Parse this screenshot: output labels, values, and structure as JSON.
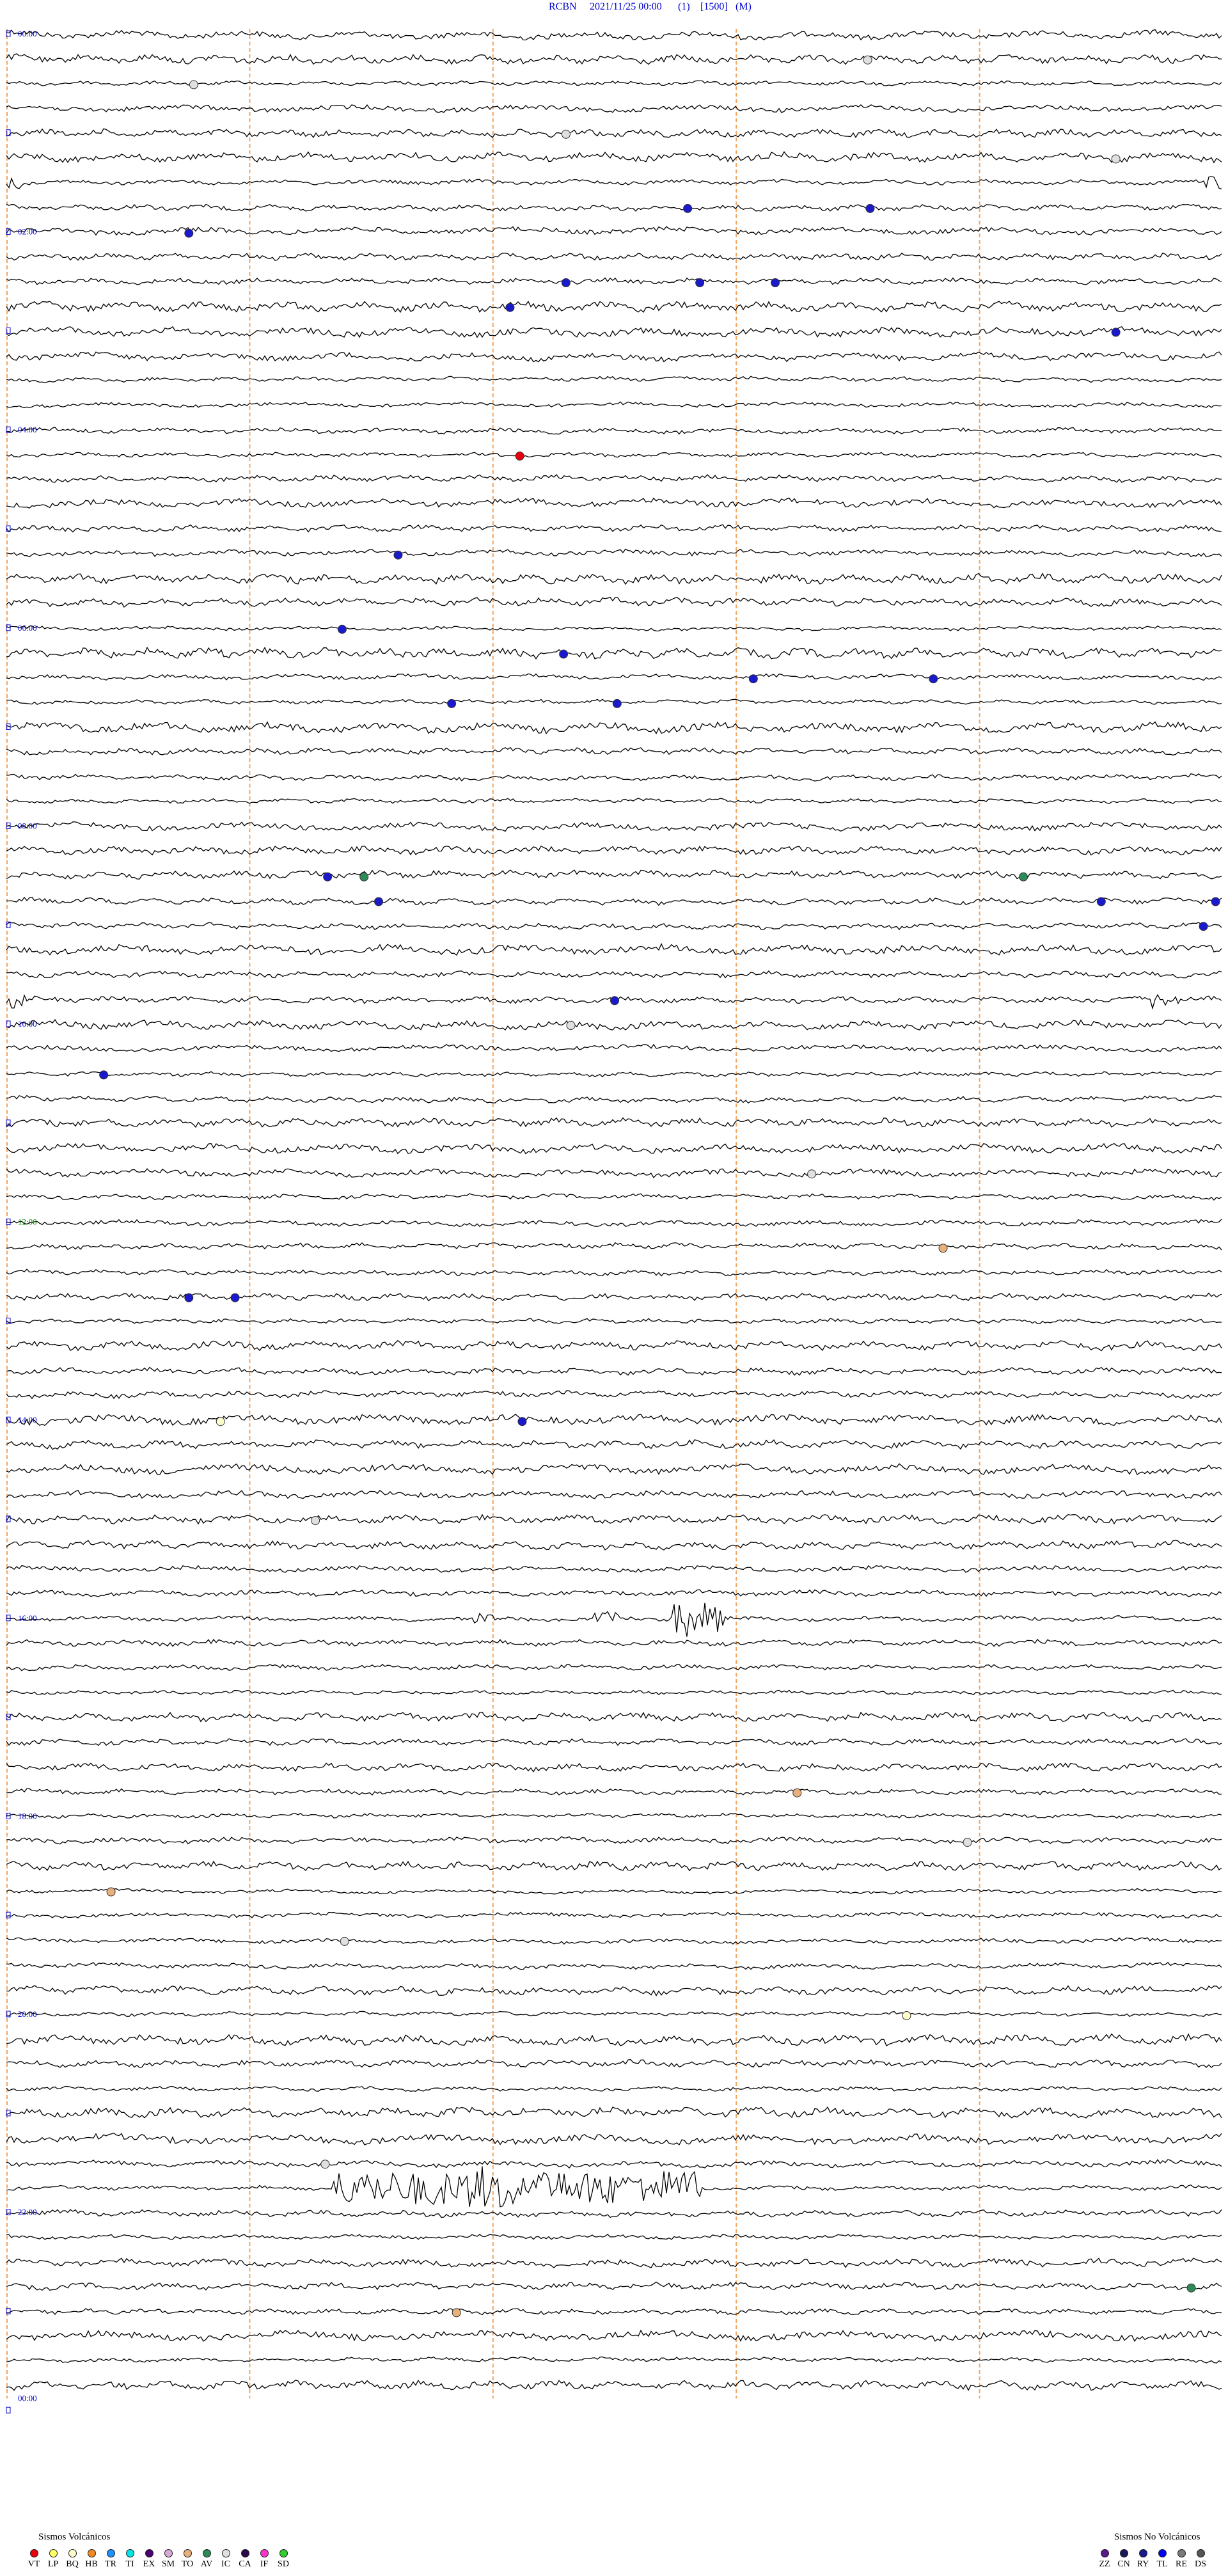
{
  "header": {
    "station": "RCBN",
    "datetime": "2021/11/25 00:00",
    "component": "(1)",
    "scale": "[1500]",
    "mode": "(M)"
  },
  "colors": {
    "trace": "#000000",
    "minute_marker": "#f4a460",
    "time_label": "#0000cc",
    "time_label_noon": "#008800"
  },
  "chart_data": {
    "type": "helicorder",
    "rows_per_hour": 4,
    "hours": 24,
    "time_labels": [
      "00:00",
      "02:00",
      "04:00",
      "06:00",
      "08:00",
      "10:00",
      "12:00",
      "14:00",
      "16:00",
      "18:00",
      "20:00",
      "22:00",
      "00:00"
    ],
    "minute_marks": [
      10,
      20,
      30,
      40
    ],
    "events": [
      {
        "row": 7,
        "minute": 28.0,
        "type": "LP"
      },
      {
        "row": 7,
        "minute": 35.5,
        "type": "LP"
      },
      {
        "row": 8,
        "minute": 7.5,
        "type": "LP"
      },
      {
        "row": 10,
        "minute": 23.0,
        "type": "LP"
      },
      {
        "row": 10,
        "minute": 28.5,
        "type": "LP"
      },
      {
        "row": 10,
        "minute": 31.6,
        "type": "LP"
      },
      {
        "row": 11,
        "minute": 20.7,
        "type": "LP"
      },
      {
        "row": 12,
        "minute": 45.6,
        "type": "LP"
      },
      {
        "row": 17,
        "minute": 21.1,
        "type": "VT"
      },
      {
        "row": 21,
        "minute": 16.1,
        "type": "LP"
      },
      {
        "row": 24,
        "minute": 13.8,
        "type": "LP"
      },
      {
        "row": 25,
        "minute": 22.9,
        "type": "LP"
      },
      {
        "row": 26,
        "minute": 30.7,
        "type": "LP"
      },
      {
        "row": 26,
        "minute": 38.1,
        "type": "LP"
      },
      {
        "row": 27,
        "minute": 18.3,
        "type": "LP"
      },
      {
        "row": 27,
        "minute": 25.1,
        "type": "LP"
      },
      {
        "row": 34,
        "minute": 13.2,
        "type": "LP"
      },
      {
        "row": 34,
        "minute": 14.7,
        "type": "AV"
      },
      {
        "row": 34,
        "minute": 41.8,
        "type": "AV"
      },
      {
        "row": 35,
        "minute": 15.3,
        "type": "LP"
      },
      {
        "row": 35,
        "minute": 45.0,
        "type": "LP"
      },
      {
        "row": 35,
        "minute": 49.7,
        "type": "LP"
      },
      {
        "row": 36,
        "minute": 49.2,
        "type": "LP"
      },
      {
        "row": 39,
        "minute": 25.0,
        "type": "LP"
      },
      {
        "row": 40,
        "minute": 23.2,
        "type": "IC"
      },
      {
        "row": 42,
        "minute": 4.0,
        "type": "LP"
      },
      {
        "row": 46,
        "minute": 33.1,
        "type": "IC"
      },
      {
        "row": 49,
        "minute": 38.5,
        "type": "TO"
      },
      {
        "row": 51,
        "minute": 7.5,
        "type": "LP"
      },
      {
        "row": 51,
        "minute": 9.4,
        "type": "LP"
      },
      {
        "row": 56,
        "minute": 21.2,
        "type": "LP"
      },
      {
        "row": 56,
        "minute": 8.8,
        "type": "BQ"
      },
      {
        "row": 60,
        "minute": 12.7,
        "type": "IC"
      },
      {
        "row": 71,
        "minute": 32.5,
        "type": "TO"
      },
      {
        "row": 73,
        "minute": 39.5,
        "type": "IC"
      },
      {
        "row": 75,
        "minute": 4.3,
        "type": "TO"
      },
      {
        "row": 77,
        "minute": 13.9,
        "type": "IC"
      },
      {
        "row": 80,
        "minute": 37.0,
        "type": "BQ"
      },
      {
        "row": 86,
        "minute": 13.1,
        "type": "IC"
      },
      {
        "row": 91,
        "minute": 48.7,
        "type": "AV"
      },
      {
        "row": 92,
        "minute": 18.5,
        "type": "TO"
      },
      {
        "row": 1,
        "minute": 35.4,
        "type": "IC"
      },
      {
        "row": 2,
        "minute": 7.7,
        "type": "IC"
      },
      {
        "row": 4,
        "minute": 23.0,
        "type": "IC"
      },
      {
        "row": 5,
        "minute": 45.6,
        "type": "IC"
      }
    ],
    "activity": [
      {
        "row": 64,
        "start": 19.2,
        "end": 20.2,
        "amp": 8
      },
      {
        "row": 64,
        "start": 24.0,
        "end": 25.2,
        "amp": 10
      },
      {
        "row": 64,
        "start": 27.3,
        "end": 29.5,
        "amp": 26
      },
      {
        "row": 87,
        "start": 13.4,
        "end": 28.5,
        "amp": 26
      },
      {
        "row": 87,
        "start": 19.0,
        "end": 20.5,
        "amp": 34
      },
      {
        "row": 39,
        "start": 47.0,
        "end": 48.2,
        "amp": 14
      },
      {
        "row": 39,
        "start": 0.2,
        "end": 1.0,
        "amp": 12
      },
      {
        "row": 6,
        "start": 0.1,
        "end": 0.8,
        "amp": 10
      },
      {
        "row": 6,
        "start": 49.3,
        "end": 50.0,
        "amp": 10
      }
    ]
  },
  "legend_volcanic": {
    "title": "Sismos Volcánicos",
    "items": [
      {
        "label": "VT",
        "color": "#e8000b"
      },
      {
        "label": "LP",
        "color": "#ffff66"
      },
      {
        "label": "BQ",
        "color": "#ffffcc"
      },
      {
        "label": "HB",
        "color": "#f08a24"
      },
      {
        "label": "TR",
        "color": "#1e90ff"
      },
      {
        "label": "TI",
        "color": "#00e5e5"
      },
      {
        "label": "EX",
        "color": "#4b006e"
      },
      {
        "label": "SM",
        "color": "#d8a8d8"
      },
      {
        "label": "TO",
        "color": "#e8b07a"
      },
      {
        "label": "AV",
        "color": "#2e8b57"
      },
      {
        "label": "IC",
        "color": "#e0e0e0"
      },
      {
        "label": "CA",
        "color": "#2a0a4a"
      },
      {
        "label": "IF",
        "color": "#ff33cc"
      },
      {
        "label": "SD",
        "color": "#33cc33"
      }
    ]
  },
  "legend_nonvolcanic": {
    "title": "Sismos No Volcánicos",
    "items": [
      {
        "label": "ZZ",
        "color": "#5a1a8a"
      },
      {
        "label": "CN",
        "color": "#1a1a5a"
      },
      {
        "label": "RY",
        "color": "#1a1a8a"
      },
      {
        "label": "TL",
        "color": "#0000ff"
      },
      {
        "label": "RE",
        "color": "#7a7a7a"
      },
      {
        "label": "DS",
        "color": "#555555"
      }
    ]
  }
}
